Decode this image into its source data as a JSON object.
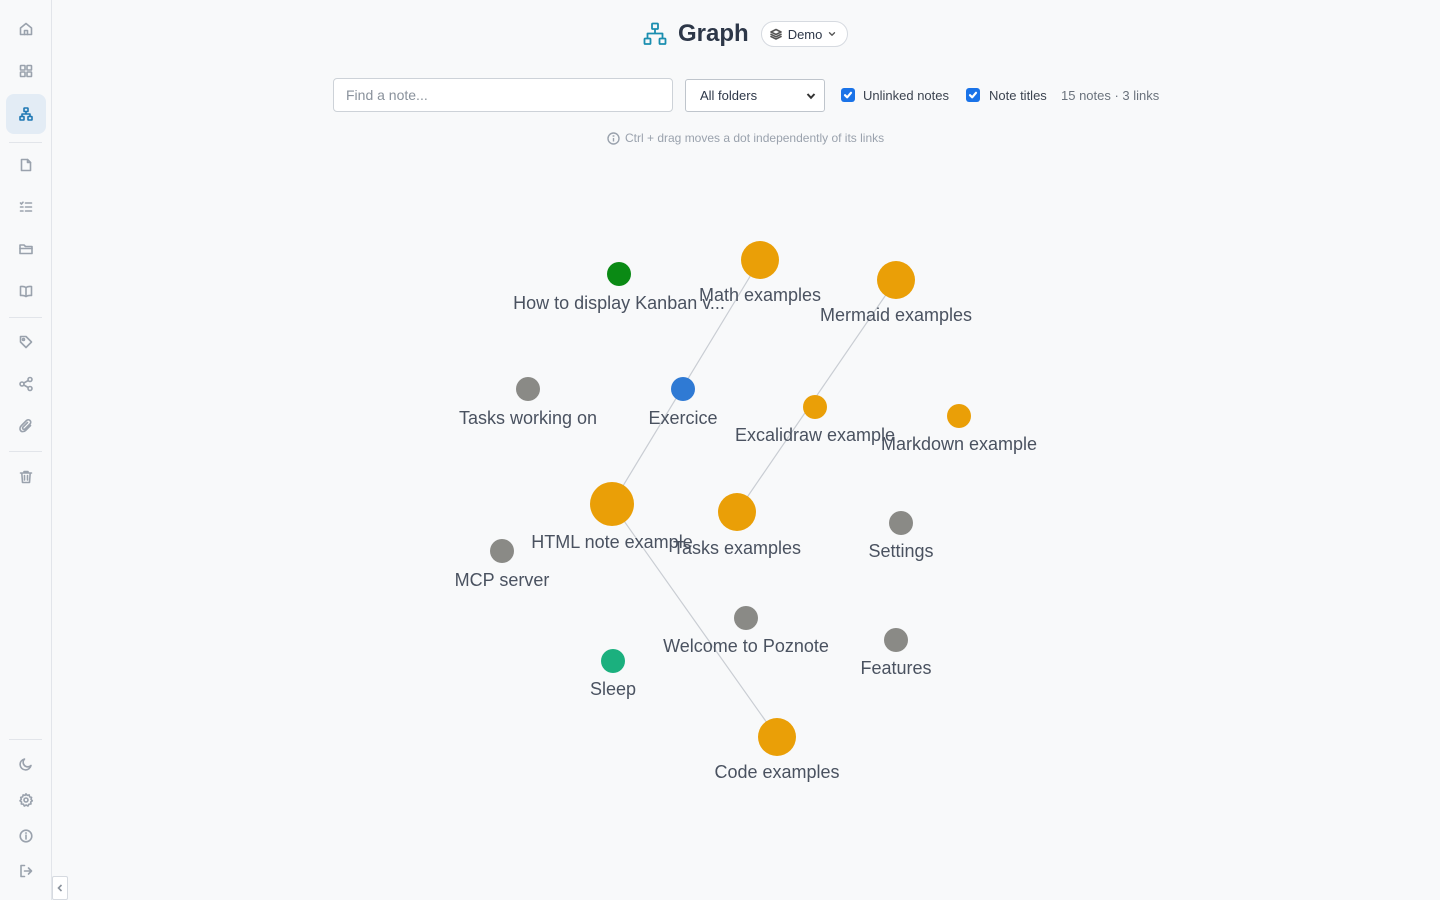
{
  "sidebar": {
    "top_items": [
      {
        "id": "home",
        "icon": "home-icon"
      },
      {
        "id": "dashboard",
        "icon": "grid-icon"
      },
      {
        "id": "graph",
        "icon": "graph-icon",
        "active": true
      }
    ],
    "note_items": [
      {
        "id": "notes",
        "icon": "file-icon"
      },
      {
        "id": "tasks",
        "icon": "checklist-icon"
      },
      {
        "id": "folders",
        "icon": "folder-icon"
      },
      {
        "id": "docs",
        "icon": "book-icon"
      }
    ],
    "meta_items": [
      {
        "id": "tags",
        "icon": "tag-icon"
      },
      {
        "id": "shared",
        "icon": "share-icon"
      },
      {
        "id": "attachments",
        "icon": "paperclip-icon"
      }
    ],
    "trash_item": {
      "id": "trash",
      "icon": "trash-icon"
    },
    "bottom_items": [
      {
        "id": "theme",
        "icon": "moon-icon"
      },
      {
        "id": "settings",
        "icon": "gear-icon"
      },
      {
        "id": "about",
        "icon": "info-icon"
      },
      {
        "id": "logout",
        "icon": "logout-icon"
      }
    ]
  },
  "header": {
    "title": "Graph",
    "workspace": "Demo"
  },
  "toolbar": {
    "search_placeholder": "Find a note...",
    "search_value": "",
    "folder_selected": "All folders",
    "unlinked_label": "Unlinked notes",
    "unlinked_checked": true,
    "titles_label": "Note titles",
    "titles_checked": true,
    "stats": "15 notes · 3 links"
  },
  "hint": "Ctrl + drag moves a dot independently of its links",
  "colors": {
    "orange": "#ea9f07",
    "gray": "#8a8a86",
    "blue": "#2f7ad4",
    "dark_green": "#0a8a14",
    "teal": "#1bb07e",
    "link": "#c9cdd3",
    "accent": "#1a8eb0"
  },
  "graph": {
    "nodes": [
      {
        "id": "kanban",
        "label": "How to display Kanban v..."
      },
      {
        "id": "math",
        "label": "Math examples"
      },
      {
        "id": "mermaid",
        "label": "Mermaid examples"
      },
      {
        "id": "tasks-working",
        "label": "Tasks working on"
      },
      {
        "id": "exercice",
        "label": "Exercice"
      },
      {
        "id": "excalidraw",
        "label": "Excalidraw example"
      },
      {
        "id": "markdown",
        "label": "Markdown example"
      },
      {
        "id": "html",
        "label": "HTML note example"
      },
      {
        "id": "tasks-ex",
        "label": "Tasks examples"
      },
      {
        "id": "settings",
        "label": "Settings"
      },
      {
        "id": "mcp",
        "label": "MCP server"
      },
      {
        "id": "welcome",
        "label": "Welcome to Poznote"
      },
      {
        "id": "features",
        "label": "Features"
      },
      {
        "id": "sleep",
        "label": "Sleep"
      },
      {
        "id": "code",
        "label": "Code examples"
      }
    ],
    "links": [
      {
        "from": "math",
        "to": "html"
      },
      {
        "from": "mermaid",
        "to": "tasks-ex"
      },
      {
        "from": "html",
        "to": "code"
      }
    ]
  }
}
